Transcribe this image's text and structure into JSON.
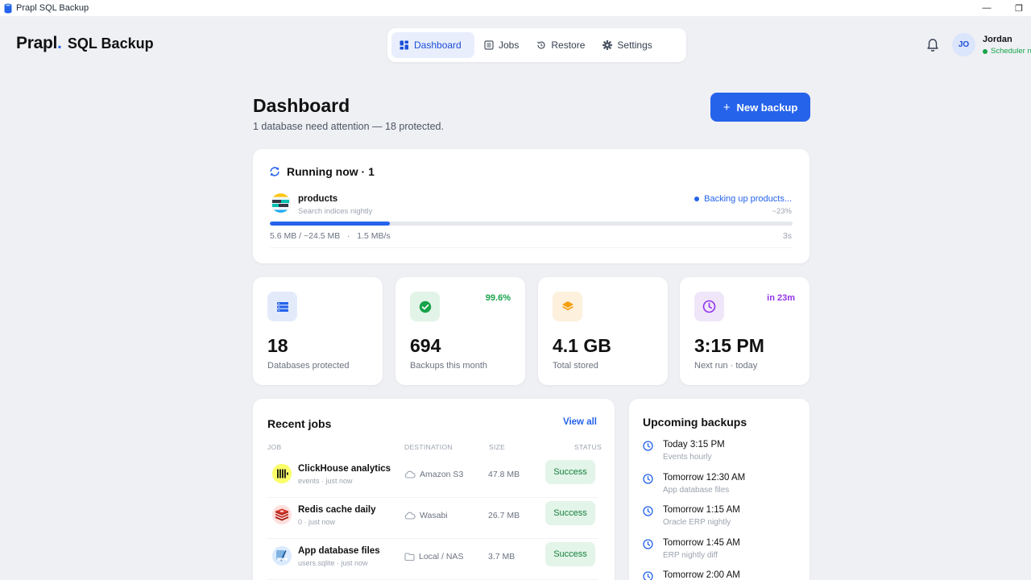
{
  "window": {
    "title": "Prapl SQL Backup",
    "minimize_glyph": "—",
    "restore_glyph": "❐"
  },
  "header": {
    "brand": "Prapl",
    "brand_dot": ".",
    "product": "SQL Backup",
    "nav": [
      {
        "label": "Dashboard",
        "icon": "grid-icon",
        "active": true
      },
      {
        "label": "Jobs",
        "icon": "list-icon"
      },
      {
        "label": "Restore",
        "icon": "history-icon"
      },
      {
        "label": "Settings",
        "icon": "gear-icon"
      }
    ],
    "user": {
      "initials": "JO",
      "name": "Jordan",
      "status": "Scheduler running"
    }
  },
  "page": {
    "title": "Dashboard",
    "subtitle": "1 database need attention — 18 protected.",
    "new_backup_plus": "+",
    "new_backup_label": "New backup"
  },
  "running": {
    "title": "Running now · 1",
    "job": {
      "name": "products",
      "description": "Search indices nightly",
      "status": "Backing up products...",
      "percent_label": "~23%",
      "progress_fraction": 0.23,
      "bytes": "5.6 MB / ~24.5 MB",
      "rate_sep": "·",
      "rate": "1.5 MB/s",
      "elapsed": "3s"
    }
  },
  "stats": [
    {
      "value": "18",
      "label": "Databases protected",
      "badge": "",
      "icon": "database-stack-icon",
      "color": "#2563eb",
      "bg": "#e3ebfb"
    },
    {
      "value": "694",
      "label": "Backups this month",
      "badge": "99.6%",
      "icon": "check-circle-icon",
      "color": "#16a34a",
      "bg": "#e2f4e7"
    },
    {
      "value": "4.1 GB",
      "label": "Total stored",
      "badge": "",
      "icon": "layers-icon",
      "color": "#f59e0b",
      "bg": "#fdf0dc"
    },
    {
      "value": "3:15 PM",
      "label": "Next run · today",
      "badge": "in 23m",
      "icon": "clock-icon",
      "color": "#9333ea",
      "bg": "#efe6fa"
    }
  ],
  "recent_jobs": {
    "title": "Recent jobs",
    "view_all": "View all",
    "columns": {
      "job": "JOB",
      "destination": "DESTINATION",
      "size": "SIZE",
      "status": "STATUS"
    },
    "rows": [
      {
        "name": "ClickHouse analytics",
        "sub": "events · just now",
        "destination": "Amazon S3",
        "dest_icon": "cloud-icon",
        "size": "47.8 MB",
        "status": "Success",
        "logo": "clickhouse-logo"
      },
      {
        "name": "Redis cache daily",
        "sub": "0 · just now",
        "destination": "Wasabi",
        "dest_icon": "cloud-icon",
        "size": "26.7 MB",
        "status": "Success",
        "logo": "redis-logo"
      },
      {
        "name": "App database files",
        "sub": "users.sqlite · just now",
        "destination": "Local / NAS",
        "dest_icon": "folder-icon",
        "size": "3.7 MB",
        "status": "Success",
        "logo": "sqlite-logo"
      }
    ]
  },
  "upcoming": {
    "title": "Upcoming backups",
    "items": [
      {
        "time": "Today 3:15 PM",
        "sub": "Events hourly"
      },
      {
        "time": "Tomorrow 12:30 AM",
        "sub": "App database files"
      },
      {
        "time": "Tomorrow 1:15 AM",
        "sub": "Oracle ERP nightly"
      },
      {
        "time": "Tomorrow 1:45 AM",
        "sub": "ERP nightly diff"
      },
      {
        "time": "Tomorrow 2:00 AM",
        "sub": ""
      }
    ]
  },
  "colors": {
    "accent": "#2563eb",
    "success": "#16a34a",
    "background": "#eff0f4"
  }
}
